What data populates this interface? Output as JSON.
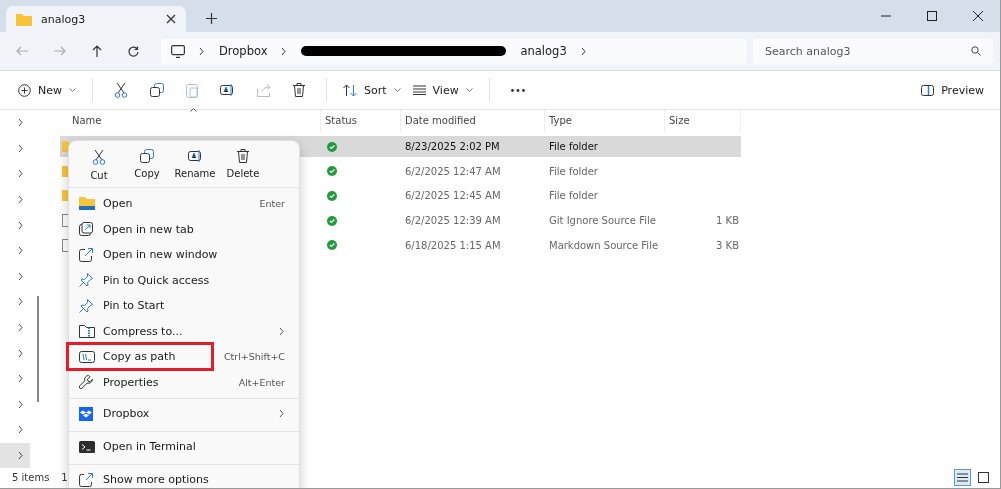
{
  "window": {
    "tab": {
      "title": "analog3"
    }
  },
  "breadcrumb": [
    {
      "kind": "folder",
      "label": "Dropbox"
    },
    {
      "kind": "redacted"
    },
    {
      "kind": "folder",
      "label": "analog3"
    }
  ],
  "search": {
    "placeholder": "Search analog3"
  },
  "toolbar": {
    "new": "New",
    "sort": "Sort",
    "view": "View",
    "preview": "Preview"
  },
  "nav_pane": [
    {
      "selected": false
    },
    {
      "selected": false
    },
    {
      "selected": false
    },
    {
      "selected": false
    },
    {
      "selected": false
    },
    {
      "selected": false
    },
    {
      "selected": false
    },
    {
      "selected": false
    },
    {
      "selected": false
    },
    {
      "selected": false
    },
    {
      "selected": false
    },
    {
      "selected": false
    },
    {
      "selected": false
    },
    {
      "selected": true
    }
  ],
  "table": {
    "columns": [
      "Name",
      "Status",
      "Date modified",
      "Type",
      "Size"
    ],
    "rows": [
      {
        "kind": "folder",
        "date": "8/23/2025 2:02 PM",
        "type": "File folder",
        "size": "",
        "selected": true
      },
      {
        "kind": "folder",
        "date": "6/2/2025 12:47 AM",
        "type": "File folder",
        "size": "",
        "selected": false
      },
      {
        "kind": "folder",
        "date": "6/2/2025 12:45 AM",
        "type": "File folder",
        "size": "",
        "selected": false
      },
      {
        "kind": "file",
        "date": "6/2/2025 12:39 AM",
        "type": "Git Ignore Source File",
        "size": "1 KB",
        "selected": false
      },
      {
        "kind": "file",
        "date": "6/18/2025 1:15 AM",
        "type": "Markdown Source File",
        "size": "3 KB",
        "selected": false
      }
    ]
  },
  "context_menu": {
    "quick_actions": [
      {
        "kind": "cut",
        "label": "Cut"
      },
      {
        "kind": "copy",
        "label": "Copy"
      },
      {
        "kind": "rename",
        "label": "Rename"
      },
      {
        "kind": "delete",
        "label": "Delete"
      }
    ],
    "items": [
      {
        "kind": "open",
        "label": "Open",
        "shortcut": "Enter",
        "submenu": false,
        "highlighted": false,
        "separator_before": false
      },
      {
        "kind": "newtab",
        "label": "Open in new tab",
        "submenu": false,
        "highlighted": false,
        "separator_before": false
      },
      {
        "kind": "newwindow",
        "label": "Open in new window",
        "submenu": false,
        "highlighted": false,
        "separator_before": false
      },
      {
        "kind": "pin",
        "label": "Pin to Quick access",
        "submenu": false,
        "highlighted": false,
        "separator_before": false
      },
      {
        "kind": "pin",
        "label": "Pin to Start",
        "submenu": false,
        "highlighted": false,
        "separator_before": false
      },
      {
        "kind": "compress",
        "label": "Compress to...",
        "submenu": true,
        "highlighted": false,
        "separator_before": false
      },
      {
        "kind": "path",
        "label": "Copy as path",
        "shortcut": "Ctrl+Shift+C",
        "submenu": false,
        "highlighted": true,
        "separator_before": false
      },
      {
        "kind": "properties",
        "label": "Properties",
        "shortcut": "Alt+Enter",
        "submenu": false,
        "highlighted": false,
        "separator_before": false
      },
      {
        "kind": "dropbox",
        "label": "Dropbox",
        "submenu": true,
        "highlighted": false,
        "separator_before": true
      },
      {
        "kind": "terminal",
        "label": "Open in Terminal",
        "submenu": false,
        "highlighted": false,
        "separator_before": true
      },
      {
        "kind": "more",
        "label": "Show more options",
        "submenu": false,
        "highlighted": false,
        "separator_before": true
      }
    ]
  },
  "status_bar": [
    "5 items",
    "1"
  ],
  "view_buttons": [
    {
      "kind": "details",
      "selected": true
    },
    {
      "kind": "tiles",
      "selected": false
    }
  ]
}
